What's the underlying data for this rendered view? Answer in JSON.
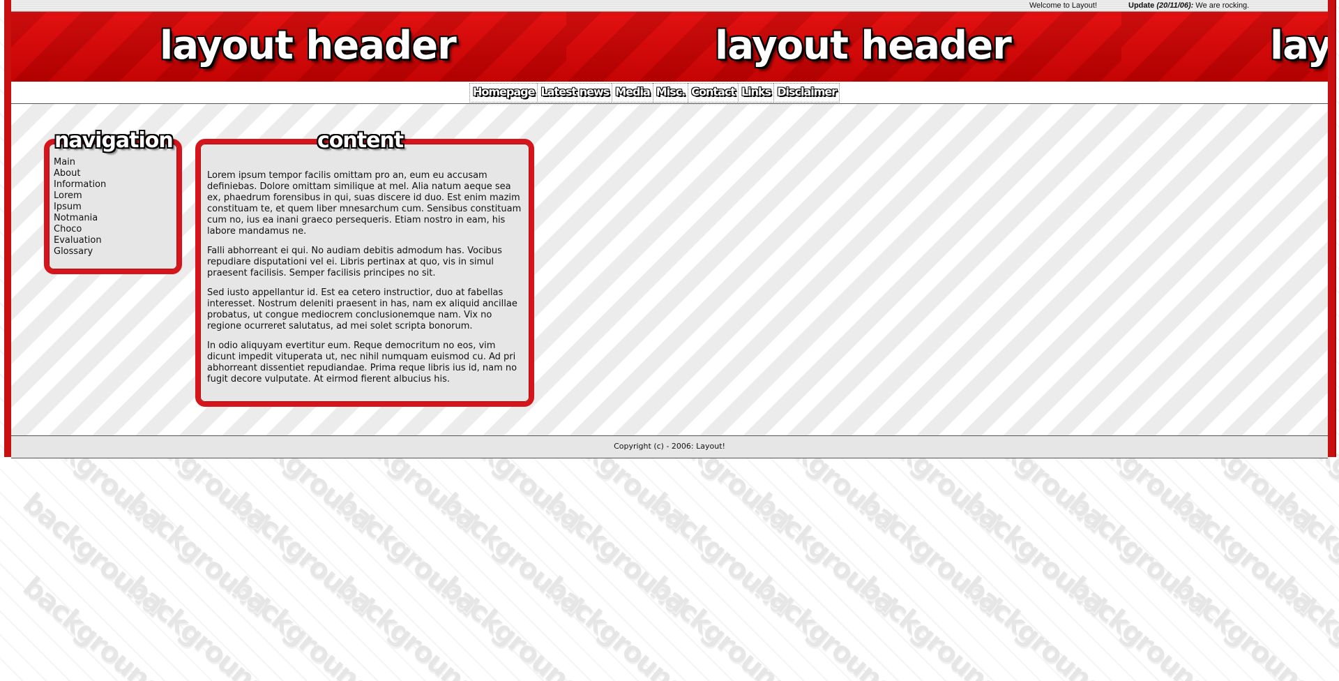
{
  "topbar": {
    "welcome": "Welcome to Layout!",
    "update_label": "Update",
    "update_date": "(20/11/06):",
    "update_text": "We are rocking."
  },
  "header": {
    "title": "layout header"
  },
  "nav_tabs": [
    "Homepage",
    "Latest news",
    "Media",
    "Misc.",
    "Contact",
    "Links",
    "Disclaimer"
  ],
  "sidebar": {
    "title": "navigation",
    "items": [
      "Main",
      "About",
      "Information",
      "Lorem",
      "Ipsum",
      "Notmania",
      "Choco",
      "Evaluation",
      "Glossary"
    ]
  },
  "content": {
    "title": "content",
    "paragraphs": [
      "Lorem ipsum tempor facilis omittam pro an, eum eu accusam definiebas. Dolore omittam similique at mel. Alia natum aeque sea ex, phaedrum forensibus in qui, suas discere id duo. Est enim mazim constituam te, et quem liber mnesarchum cum. Sensibus constituam cum no, ius ea inani graeco persequeris. Etiam nostro in eam, his labore mandamus ne.",
      "Falli abhorreant ei qui. No audiam debitis admodum has. Vocibus repudiare disputationi vel ei. Libris pertinax at quo, vis in simul praesent facilisis. Semper facilisis principes no sit.",
      "Sed iusto appellantur id. Est ea cetero instructior, duo at fabellas interesset. Nostrum deleniti praesent in has, nam ex aliquid ancillae probatus, ut congue mediocrem conclusionemque nam. Vix no regione ocurreret salutatus, ad mei solet scripta bonorum.",
      "In odio aliquyam evertitur eum. Reque democritum no eos, vim dicunt impedit vituperata ut, nec nihil numquam euismod cu. Ad pri abhorreant dissentiet repudiandae. Prima reque libris ius id, nam no fugit decore vulputate. At eirmod fierent albucius his."
    ]
  },
  "footer": {
    "copyright": "Copyright (c) - 2006: Layout!"
  },
  "background": {
    "watermark_text": "background"
  },
  "colors": {
    "accent_red": "#d5151b",
    "header_red": "#d00000",
    "box_fill": "#e6e6e6"
  }
}
